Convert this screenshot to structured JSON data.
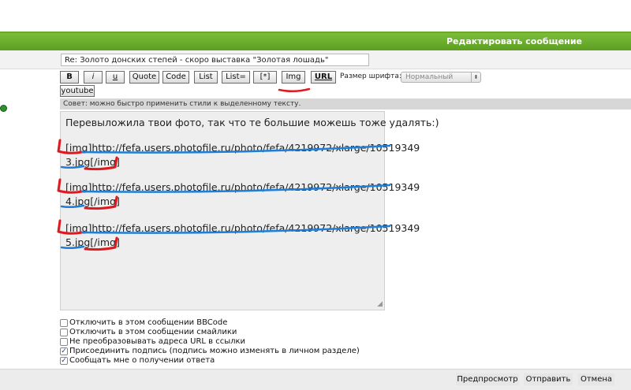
{
  "header": {
    "title": "Редактировать сообщение"
  },
  "subject": {
    "value": "Re: Золото донских степей - скоро выставка \"Золотая лошадь\""
  },
  "toolbar": {
    "buttons": [
      "B",
      "i",
      "u",
      "Quote",
      "Code",
      "List",
      "List=",
      "[*]",
      "Img",
      "URL"
    ],
    "youtube": "youtube",
    "font_size_label": "Размер шрифта:",
    "font_size_value": "Нормальный"
  },
  "tip": "Совет: можно быстро применить стили к выделенному тексту.",
  "message": {
    "intro": "Перевыложила твои фото, так что те большие можешь тоже удалять:)",
    "lines": [
      "[img]http://fefa.users.photofile.ru/photo/fefa/4219972/xlarge/10519349",
      "3.jpg[/img]",
      "[img]http://fefa.users.photofile.ru/photo/fefa/4219972/xlarge/10519349",
      "4.jpg[/img]",
      "[img]http://fefa.users.photofile.ru/photo/fefa/4219972/xlarge/10519349",
      "5.jpg[/img]"
    ]
  },
  "options": [
    {
      "label": "Отключить в этом сообщении BBCode",
      "checked": false
    },
    {
      "label": "Отключить в этом сообщении смайлики",
      "checked": false
    },
    {
      "label": "Не преобразовывать адреса URL в ссылки",
      "checked": false
    },
    {
      "label": "Присоединить подпись (подпись можно изменять в личном разделе)",
      "checked": true
    },
    {
      "label": "Сообщать мне о получении ответа",
      "checked": true
    }
  ],
  "footer": {
    "preview": "Предпросмотр",
    "submit": "Отправить",
    "cancel": "Отмена"
  },
  "colors": {
    "accent_green": "#6aaa2c",
    "mark_red": "#e0191f",
    "mark_blue": "#1e7fd8"
  }
}
